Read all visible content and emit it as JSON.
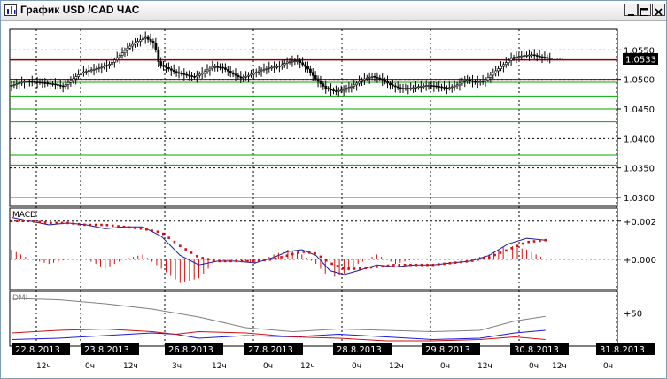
{
  "window": {
    "title": "График USD /CAD ЧАС"
  },
  "colors": {
    "accent_price_line": "#8b0000",
    "support_lines": "#00aa00",
    "macd_line": "#1a1aa0",
    "signal_dots": "#d01010",
    "histogram": "#d01010",
    "dmi_plus": "#1a1ae0",
    "dmi_minus": "#d01010",
    "adx": "#808080"
  },
  "icons": {
    "title": "chart-icon"
  },
  "chart_data": [
    {
      "type": "candlestick",
      "title": "",
      "current_price": "1.0533",
      "y_ticks": [
        "1.0550",
        "1.0500",
        "1.0450",
        "1.0400",
        "1.0350",
        "1.0300"
      ],
      "ylim": [
        1.0285,
        1.0585
      ],
      "resistance_line": 1.0533,
      "support_lines": [
        1.0495,
        1.0472,
        1.045,
        1.0428,
        1.0372,
        1.0355,
        1.03
      ],
      "date_labels": [
        "22.8.2013",
        "23.8.2013",
        "26.8.2013",
        "27.8.2013",
        "28.8.2013",
        "29.8.2013",
        "30.8.2013",
        "31.8.2013"
      ],
      "hour_labels": [
        "12ч",
        "0ч",
        "12ч",
        "3ч",
        "12ч",
        "0ч",
        "12ч",
        "0ч",
        "12ч",
        "0ч",
        "12ч",
        "0ч",
        "12ч",
        "0ч"
      ],
      "close_path": [
        [
          0,
          1.049
        ],
        [
          6,
          1.0497
        ],
        [
          12,
          1.0495
        ],
        [
          18,
          1.0492
        ],
        [
          22,
          1.0488
        ],
        [
          26,
          1.05
        ],
        [
          30,
          1.0512
        ],
        [
          34,
          1.0516
        ],
        [
          38,
          1.052
        ],
        [
          42,
          1.0526
        ],
        [
          46,
          1.054
        ],
        [
          50,
          1.0555
        ],
        [
          54,
          1.0565
        ],
        [
          57,
          1.0572
        ],
        [
          61,
          1.056
        ],
        [
          63,
          1.0525
        ],
        [
          66,
          1.052
        ],
        [
          70,
          1.0512
        ],
        [
          74,
          1.0508
        ],
        [
          78,
          1.0504
        ],
        [
          82,
          1.0512
        ],
        [
          86,
          1.0522
        ],
        [
          90,
          1.052
        ],
        [
          94,
          1.051
        ],
        [
          98,
          1.0502
        ],
        [
          102,
          1.0508
        ],
        [
          106,
          1.0515
        ],
        [
          110,
          1.052
        ],
        [
          114,
          1.0522
        ],
        [
          118,
          1.053
        ],
        [
          122,
          1.0532
        ],
        [
          126,
          1.052
        ],
        [
          130,
          1.05
        ],
        [
          134,
          1.0485
        ],
        [
          138,
          1.048
        ],
        [
          142,
          1.0483
        ],
        [
          146,
          1.049
        ],
        [
          150,
          1.05
        ],
        [
          154,
          1.0505
        ],
        [
          158,
          1.05
        ],
        [
          162,
          1.049
        ],
        [
          166,
          1.0485
        ],
        [
          170,
          1.0485
        ],
        [
          174,
          1.0488
        ],
        [
          178,
          1.049
        ],
        [
          182,
          1.0488
        ],
        [
          186,
          1.0485
        ],
        [
          190,
          1.049
        ],
        [
          194,
          1.05
        ],
        [
          198,
          1.0495
        ],
        [
          202,
          1.0498
        ],
        [
          206,
          1.0512
        ],
        [
          210,
          1.0525
        ],
        [
          214,
          1.0537
        ],
        [
          218,
          1.054
        ],
        [
          222,
          1.0542
        ],
        [
          226,
          1.0538
        ],
        [
          230,
          1.0536
        ]
      ]
    },
    {
      "type": "line",
      "title": "MACD",
      "y_ticks": [
        "+0.002",
        "+0.000"
      ],
      "ylim": [
        -0.0015,
        0.0025
      ],
      "macd": [
        [
          0,
          0.0022
        ],
        [
          8,
          0.002
        ],
        [
          16,
          0.0018
        ],
        [
          24,
          0.0019
        ],
        [
          32,
          0.0018
        ],
        [
          40,
          0.0016
        ],
        [
          48,
          0.0017
        ],
        [
          56,
          0.0017
        ],
        [
          64,
          0.0012
        ],
        [
          72,
          0.0002
        ],
        [
          80,
          -0.0003
        ],
        [
          88,
          -0.0001
        ],
        [
          96,
          -0.0001
        ],
        [
          104,
          -0.0002
        ],
        [
          112,
          0.0001
        ],
        [
          118,
          0.0004
        ],
        [
          124,
          0.0005
        ],
        [
          130,
          0.0002
        ],
        [
          136,
          -0.0006
        ],
        [
          142,
          -0.0008
        ],
        [
          148,
          -0.0006
        ],
        [
          156,
          -0.0003
        ],
        [
          164,
          -0.0004
        ],
        [
          172,
          -0.0003
        ],
        [
          180,
          -0.0003
        ],
        [
          188,
          -0.0002
        ],
        [
          196,
          -0.0001
        ],
        [
          204,
          0.0002
        ],
        [
          212,
          0.0008
        ],
        [
          220,
          0.0011
        ],
        [
          228,
          0.001
        ]
      ],
      "signal": [
        [
          0,
          0.002
        ],
        [
          8,
          0.002
        ],
        [
          16,
          0.0019
        ],
        [
          24,
          0.0019
        ],
        [
          32,
          0.0018
        ],
        [
          40,
          0.0018
        ],
        [
          48,
          0.0017
        ],
        [
          56,
          0.0016
        ],
        [
          64,
          0.0014
        ],
        [
          72,
          0.0007
        ],
        [
          80,
          0.0001
        ],
        [
          88,
          -0.0001
        ],
        [
          96,
          -0.0001
        ],
        [
          104,
          -0.0001
        ],
        [
          112,
          0.0
        ],
        [
          118,
          0.0002
        ],
        [
          124,
          0.0004
        ],
        [
          130,
          0.0003
        ],
        [
          136,
          -0.0002
        ],
        [
          142,
          -0.0005
        ],
        [
          148,
          -0.0005
        ],
        [
          156,
          -0.0004
        ],
        [
          164,
          -0.0003
        ],
        [
          172,
          -0.0003
        ],
        [
          180,
          -0.0003
        ],
        [
          188,
          -0.0002
        ],
        [
          196,
          -0.0001
        ],
        [
          204,
          0.0001
        ],
        [
          212,
          0.0005
        ],
        [
          220,
          0.0009
        ],
        [
          228,
          0.001
        ]
      ]
    },
    {
      "type": "line",
      "title": "DMI",
      "y_ticks": [
        "+50"
      ],
      "ylim": [
        0,
        80
      ],
      "adx": [
        [
          0,
          72
        ],
        [
          20,
          70
        ],
        [
          40,
          64
        ],
        [
          60,
          56
        ],
        [
          80,
          44
        ],
        [
          100,
          28
        ],
        [
          120,
          22
        ],
        [
          140,
          26
        ],
        [
          160,
          24
        ],
        [
          180,
          22
        ],
        [
          200,
          24
        ],
        [
          215,
          38
        ],
        [
          228,
          45
        ]
      ],
      "plus_di": [
        [
          0,
          10
        ],
        [
          20,
          12
        ],
        [
          40,
          16
        ],
        [
          60,
          20
        ],
        [
          70,
          18
        ],
        [
          80,
          12
        ],
        [
          100,
          16
        ],
        [
          120,
          14
        ],
        [
          140,
          18
        ],
        [
          160,
          14
        ],
        [
          180,
          10
        ],
        [
          200,
          12
        ],
        [
          215,
          20
        ],
        [
          228,
          24
        ]
      ],
      "minus_di": [
        [
          0,
          20
        ],
        [
          20,
          24
        ],
        [
          40,
          26
        ],
        [
          60,
          22
        ],
        [
          70,
          18
        ],
        [
          80,
          22
        ],
        [
          100,
          20
        ],
        [
          120,
          14
        ],
        [
          140,
          12
        ],
        [
          160,
          8
        ],
        [
          180,
          8
        ],
        [
          200,
          10
        ],
        [
          215,
          14
        ],
        [
          228,
          10
        ]
      ]
    }
  ]
}
